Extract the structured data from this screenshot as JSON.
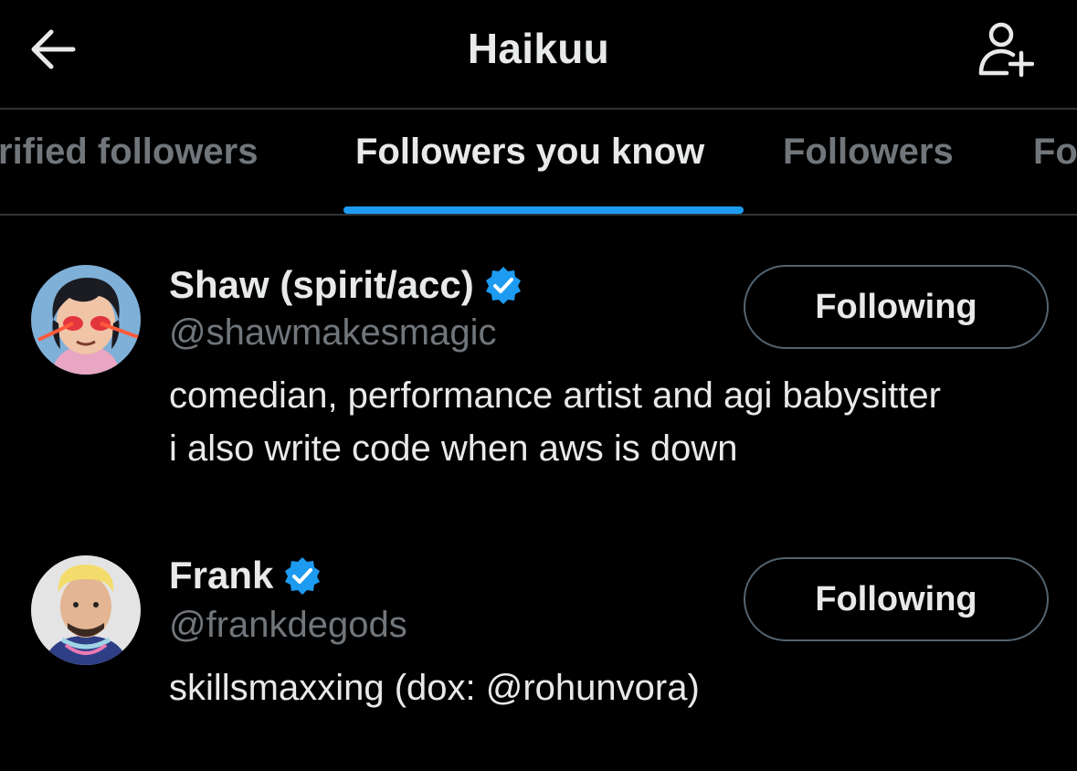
{
  "header": {
    "title": "Haikuu",
    "back_icon": "arrow-left-icon",
    "add_user_icon": "add-user-icon"
  },
  "tabs": [
    {
      "label": "Verified followers",
      "visible_text": "rified followers",
      "active": false
    },
    {
      "label": "Followers you know",
      "visible_text": "Followers you know",
      "active": true
    },
    {
      "label": "Followers",
      "visible_text": "Followers",
      "active": false
    },
    {
      "label": "Following",
      "visible_text": "Fo",
      "active": false
    }
  ],
  "users": [
    {
      "name": "Shaw (spirit/acc)",
      "handle": "@shawmakesmagic",
      "verified": true,
      "bio": [
        "comedian, performance artist and agi babysitter",
        "i also write code when aws is down"
      ],
      "button_label": "Following"
    },
    {
      "name": "Frank",
      "handle": "@frankdegods",
      "verified": true,
      "bio": [
        "skillsmaxxing (dox: @rohunvora)"
      ],
      "button_label": "Following"
    }
  ],
  "colors": {
    "background": "#000000",
    "text_primary": "#e7e9ea",
    "text_secondary": "#71767b",
    "accent": "#1d9bf0",
    "divider": "#2f3336",
    "button_border": "#536471"
  }
}
